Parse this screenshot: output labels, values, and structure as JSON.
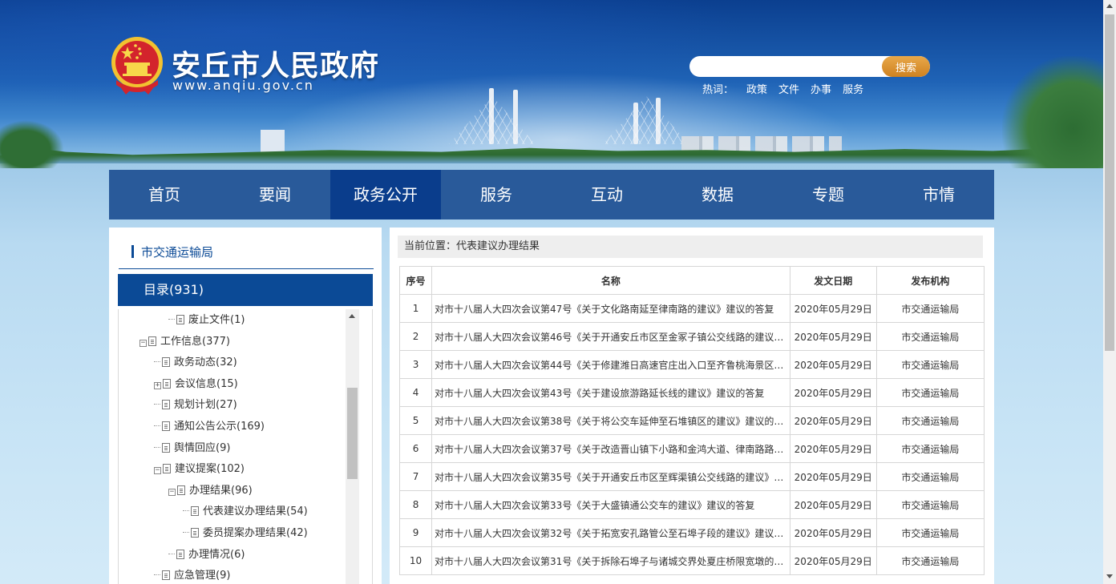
{
  "header": {
    "site_title": "安丘市人民政府",
    "site_url": "www.anqiu.gov.cn",
    "search": {
      "placeholder": "",
      "button_label": "搜索"
    },
    "hotwords": {
      "label": "热词：",
      "items": [
        "政策",
        "文件",
        "办事",
        "服务"
      ]
    }
  },
  "nav": {
    "items": [
      "首页",
      "要闻",
      "政务公开",
      "服务",
      "互动",
      "数据",
      "专题",
      "市情"
    ],
    "active_index": 2
  },
  "sidebar": {
    "dept_title": "市交通运输局",
    "catalog_label": "目录(931)",
    "tree": [
      {
        "label": "废止文件(1)",
        "level": 3,
        "toggle": ""
      },
      {
        "label": "工作信息(377)",
        "level": 1,
        "toggle": "−"
      },
      {
        "label": "政务动态(32)",
        "level": 2,
        "toggle": ""
      },
      {
        "label": "会议信息(15)",
        "level": 2,
        "toggle": "+"
      },
      {
        "label": "规划计划(27)",
        "level": 2,
        "toggle": ""
      },
      {
        "label": "通知公告公示(169)",
        "level": 2,
        "toggle": ""
      },
      {
        "label": "舆情回应(9)",
        "level": 2,
        "toggle": ""
      },
      {
        "label": "建议提案(102)",
        "level": 2,
        "toggle": "−"
      },
      {
        "label": "办理结果(96)",
        "level": 3,
        "toggle": "−"
      },
      {
        "label": "代表建议办理结果(54)",
        "level": 4,
        "toggle": ""
      },
      {
        "label": "委员提案办理结果(42)",
        "level": 4,
        "toggle": ""
      },
      {
        "label": "办理情况(6)",
        "level": 3,
        "toggle": ""
      },
      {
        "label": "应急管理(9)",
        "level": 2,
        "toggle": ""
      }
    ]
  },
  "main": {
    "breadcrumb_label": "当前位置：",
    "breadcrumb_value": "代表建议办理结果",
    "table": {
      "headers": [
        "序号",
        "名称",
        "发文日期",
        "发布机构"
      ],
      "rows": [
        [
          "1",
          "对市十八届人大四次会议第47号《关于文化路南延至律南路的建议》建议的答复",
          "2020年05月29日",
          "市交通运输局"
        ],
        [
          "2",
          "对市十八届人大四次会议第46号《关于开通安丘市区至金冢子镇公交线路的建议…",
          "2020年05月29日",
          "市交通运输局"
        ],
        [
          "3",
          "对市十八届人大四次会议第44号《关于修建潍日高速官庄出入口至齐鲁桃海景区…",
          "2020年05月29日",
          "市交通运输局"
        ],
        [
          "4",
          "对市十八届人大四次会议第43号《关于建设旅游路延长线的建议》建议的答复",
          "2020年05月29日",
          "市交通运输局"
        ],
        [
          "5",
          "对市十八届人大四次会议第38号《关于将公交车延伸至石堆镇区的建议》建议的…",
          "2020年05月29日",
          "市交通运输局"
        ],
        [
          "6",
          "对市十八届人大四次会议第37号《关于改造晋山镇下小路和金鸿大道、律南路路…",
          "2020年05月29日",
          "市交通运输局"
        ],
        [
          "7",
          "对市十八届人大四次会议第35号《关于开通安丘市区至辉渠镇公交线路的建议》…",
          "2020年05月29日",
          "市交通运输局"
        ],
        [
          "8",
          "对市十八届人大四次会议第33号《关于大盛镇通公交车的建议》建议的答复",
          "2020年05月29日",
          "市交通运输局"
        ],
        [
          "9",
          "对市十八届人大四次会议第32号《关于拓宽安孔路管公至石埠子段的建议》建议…",
          "2020年05月29日",
          "市交通运输局"
        ],
        [
          "10",
          "对市十八届人大四次会议第31号《关于拆除石埠子与诸城交界处夏庄桥限宽墩的…",
          "2020年05月29日",
          "市交通运输局"
        ]
      ]
    }
  },
  "colors": {
    "nav_bg": "#295a9a",
    "nav_active": "#0a3d8c",
    "accent": "#0b4a96",
    "search_button": "#cf8220"
  }
}
